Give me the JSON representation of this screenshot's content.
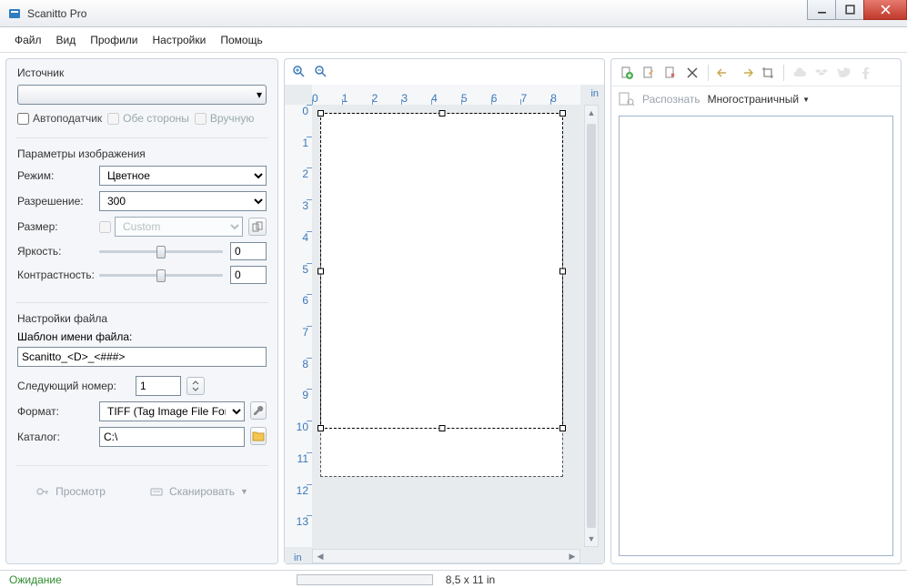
{
  "title": "Scanitto Pro",
  "menu": [
    "Файл",
    "Вид",
    "Профили",
    "Настройки",
    "Помощь"
  ],
  "source": {
    "group_label": "Источник",
    "autofeeder": "Автоподатчик",
    "bothsides": "Обе стороны",
    "manual": "Вручную"
  },
  "image_params": {
    "group_label": "Параметры изображения",
    "mode_label": "Режим:",
    "mode_value": "Цветное",
    "res_label": "Разрешение:",
    "res_value": "300",
    "size_label": "Размер:",
    "size_value": "Custom",
    "brightness_label": "Яркость:",
    "brightness_value": "0",
    "contrast_label": "Контрастность:",
    "contrast_value": "0"
  },
  "file": {
    "group_label": "Настройки файла",
    "template_label": "Шаблон имени файла:",
    "template_value": "Scanitto_<D>_<###>",
    "nextnum_label": "Следующий номер:",
    "nextnum_value": "1",
    "format_label": "Формат:",
    "format_value": "TIFF (Tag Image File Format)",
    "catalog_label": "Каталог:",
    "catalog_value": "C:\\"
  },
  "actions": {
    "preview": "Просмотр",
    "scan": "Сканировать"
  },
  "ruler": {
    "unit": "in",
    "h_ticks": [
      "0",
      "1",
      "2",
      "3",
      "4",
      "5",
      "6",
      "7",
      "8"
    ],
    "v_ticks": [
      "0",
      "1",
      "2",
      "3",
      "4",
      "5",
      "6",
      "7",
      "8",
      "9",
      "10",
      "11",
      "12",
      "13"
    ]
  },
  "right": {
    "recognize": "Распознать",
    "multipage": "Многостраничный"
  },
  "status": {
    "ready": "Ожидание",
    "size": "8,5 x 11 in"
  }
}
